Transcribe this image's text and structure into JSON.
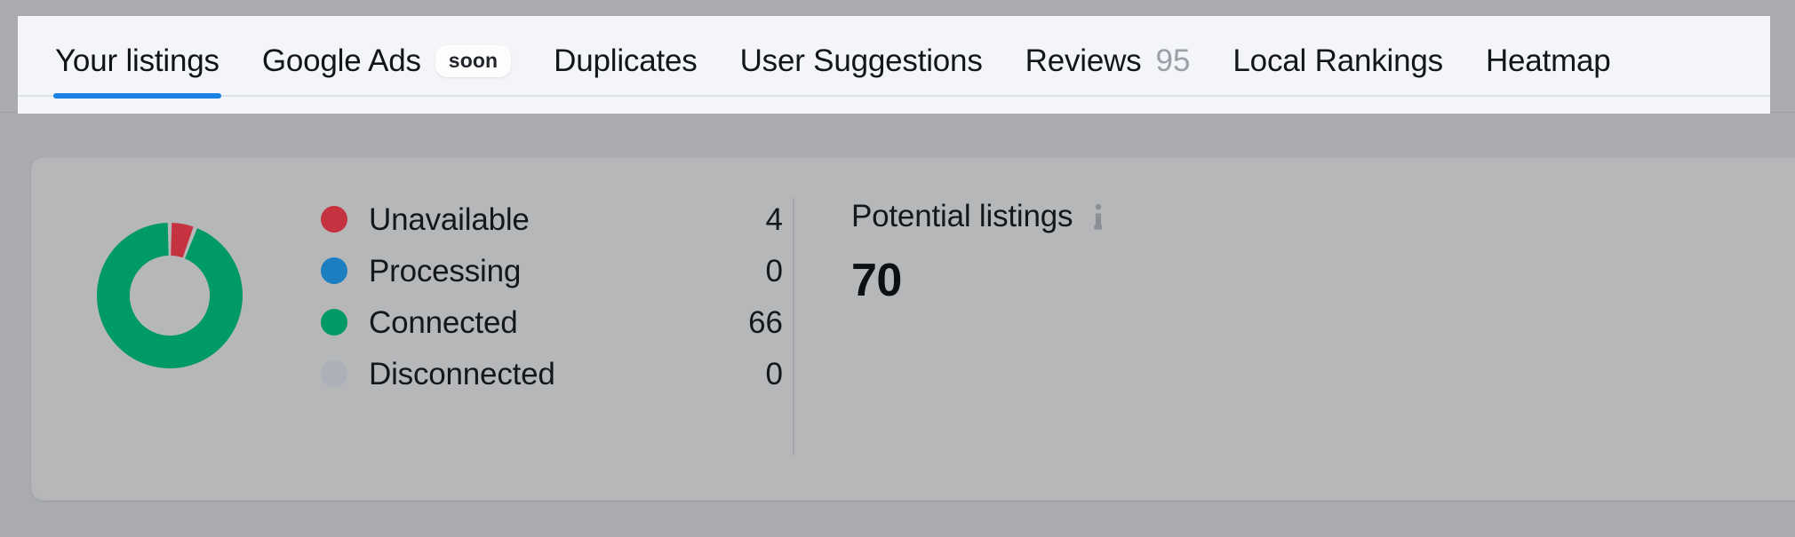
{
  "tabs": [
    {
      "label": "Your listings",
      "active": true,
      "badge": null,
      "count": null
    },
    {
      "label": "Google Ads",
      "active": false,
      "badge": "soon",
      "count": null
    },
    {
      "label": "Duplicates",
      "active": false,
      "badge": null,
      "count": null
    },
    {
      "label": "User Suggestions",
      "active": false,
      "badge": null,
      "count": null
    },
    {
      "label": "Reviews",
      "active": false,
      "badge": null,
      "count": "95"
    },
    {
      "label": "Local Rankings",
      "active": false,
      "badge": null,
      "count": null
    },
    {
      "label": "Heatmap",
      "active": false,
      "badge": null,
      "count": null
    }
  ],
  "summary_card": {
    "legend": [
      {
        "label": "Unavailable",
        "value": "4",
        "color": "#c63340"
      },
      {
        "label": "Processing",
        "value": "0",
        "color": "#1b7ec0"
      },
      {
        "label": "Connected",
        "value": "66",
        "color": "#009a66"
      },
      {
        "label": "Disconnected",
        "value": "0",
        "color": "#adb0b8"
      }
    ],
    "potential_listings": {
      "title": "Potential listings",
      "value": "70",
      "info_icon": "info-icon"
    }
  },
  "colors": {
    "accent_blue": "#1a82e2",
    "unavailable_red": "#c63340",
    "processing_blue": "#1b7ec0",
    "connected_green": "#009a66",
    "disconnected_gray": "#adb0b8",
    "page_background": "#a9abb0",
    "card_background": "#b6b7b9",
    "tabbar_background": "#f4f5f8"
  },
  "chart_data": {
    "type": "pie",
    "title": "Listings status distribution",
    "categories": [
      "Unavailable",
      "Processing",
      "Connected",
      "Disconnected"
    ],
    "values": [
      4,
      0,
      66,
      0
    ],
    "colors": [
      "#c63340",
      "#1b7ec0",
      "#009a66",
      "#adb0b8"
    ],
    "total": 70,
    "donut": true,
    "inner_radius_ratio": 0.55,
    "start_angle_deg": -90,
    "legend_position": "right",
    "grid": false
  }
}
